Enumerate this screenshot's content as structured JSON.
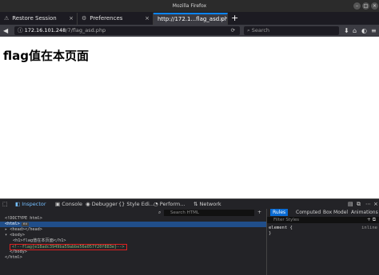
{
  "window": {
    "title": "Mozilla Firefox"
  },
  "tabs": [
    {
      "label": "Restore Session",
      "icon": "restore-icon"
    },
    {
      "label": "Preferences",
      "icon": "gear-icon"
    },
    {
      "label": "http://172.1...flag_asd.php",
      "icon": "none"
    }
  ],
  "navbar": {
    "url_host": "172.16.101.248",
    "url_path": "/7/flag_asd.php",
    "search_placeholder": "Search"
  },
  "page": {
    "heading": "flag值在本页面"
  },
  "devtools": {
    "tabs": [
      "Inspector",
      "Console",
      "Debugger",
      "Style Edi...",
      "Perform...",
      "Network"
    ],
    "search_html_placeholder": "Search HTML",
    "tree": [
      {
        "text": "<!DOCTYPE html>",
        "indent": 0,
        "selected": false
      },
      {
        "text": "<html>",
        "indent": 0,
        "selected": true,
        "badge": "ev"
      },
      {
        "text": "<head></head>",
        "indent": 1,
        "selected": false
      },
      {
        "text": "<body>",
        "indent": 1,
        "selected": false
      },
      {
        "text": "<h1>flag值在本页面</h1>",
        "indent": 2,
        "selected": false
      },
      {
        "text": "<!--flag{e18adc3949ba59abbe56e057f20f883e}-->",
        "indent": 2,
        "selected": false,
        "highlight": true
      },
      {
        "text": "</body>",
        "indent": 1,
        "selected": false
      },
      {
        "text": "</html>",
        "indent": 0,
        "selected": false
      }
    ],
    "rules_panel": {
      "tabs": [
        "Rules",
        "Computed",
        "Box Model",
        "Animations"
      ],
      "filter_placeholder": "Filter Styles",
      "rule_selector": "element {",
      "rule_close": "}",
      "rule_source": "inline"
    }
  },
  "colors": {
    "accent": "#0a84ff",
    "highlight_border": "#e02020"
  }
}
